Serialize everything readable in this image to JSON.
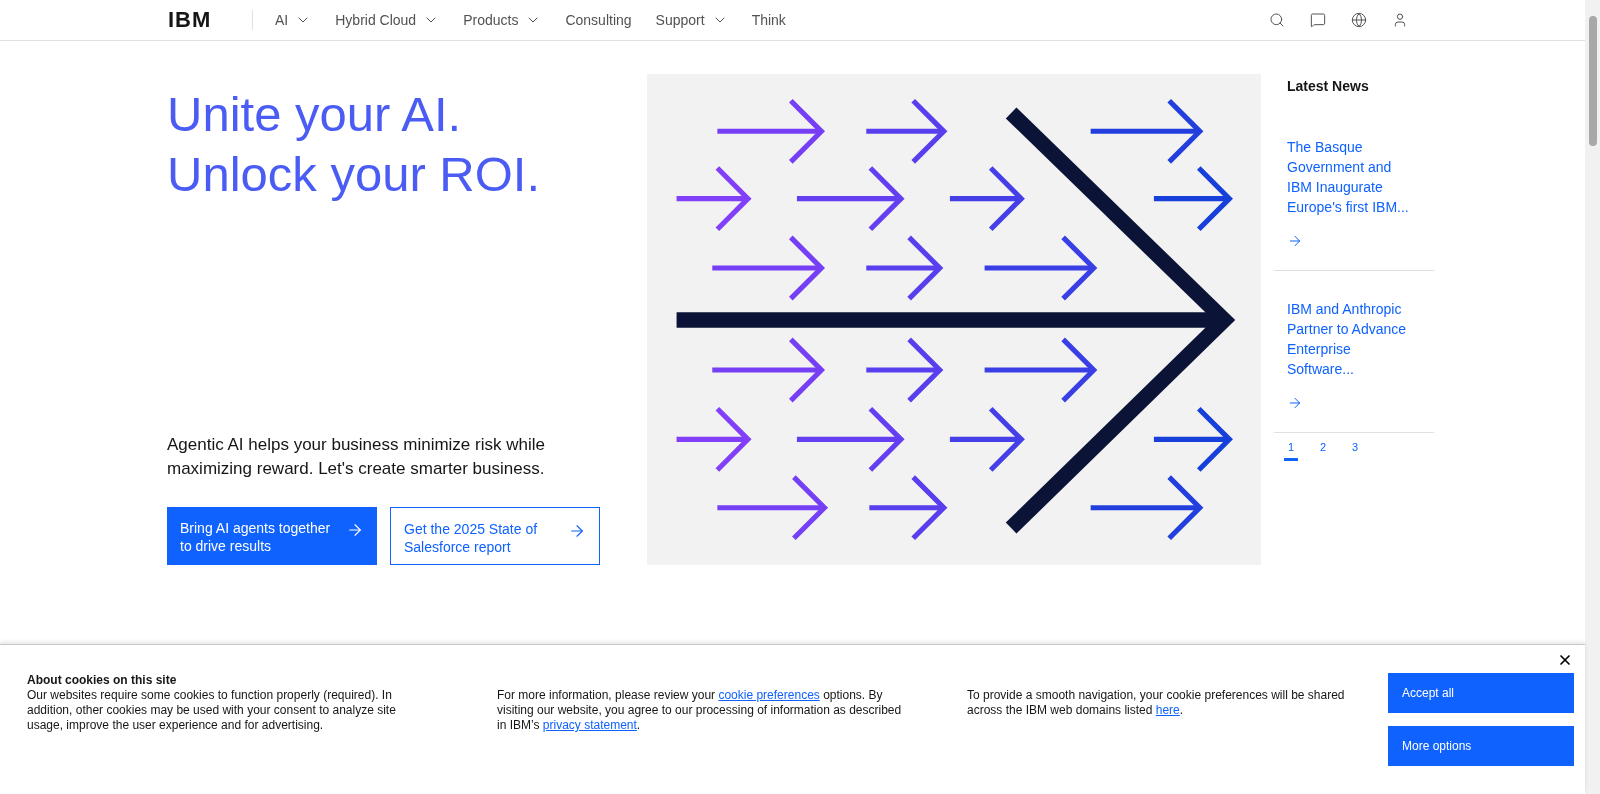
{
  "nav": {
    "logo": "IBM",
    "items": [
      {
        "label": "AI",
        "has_menu": true
      },
      {
        "label": "Hybrid Cloud",
        "has_menu": true
      },
      {
        "label": "Products",
        "has_menu": true
      },
      {
        "label": "Consulting",
        "has_menu": false
      },
      {
        "label": "Support",
        "has_menu": true
      },
      {
        "label": "Think",
        "has_menu": false
      }
    ]
  },
  "hero": {
    "title_lines": [
      "Unite your AI.",
      "Unlock your ROI."
    ],
    "description": "Agentic AI helps your business minimize risk while maximizing reward. Let's create smarter business.",
    "buttons": [
      {
        "label": "Bring AI agents together to drive results",
        "kind": "primary"
      },
      {
        "label": "Get the 2025 State of Salesforce report",
        "kind": "secondary"
      }
    ]
  },
  "news": {
    "title": "Latest News",
    "items": [
      {
        "headline": "The Basque Government and IBM Inaugurate Europe's first IBM..."
      },
      {
        "headline": "IBM and Anthropic Partner to Advance Enterprise Software..."
      }
    ],
    "pages": [
      {
        "label": "1",
        "selected": true
      },
      {
        "label": "2",
        "selected": false
      },
      {
        "label": "3",
        "selected": false
      }
    ]
  },
  "cookie_banner": {
    "title": "About cookies on this site",
    "text": "Our websites require some cookies to function properly (required). In addition, other cookies may be used with your consent to analyze site usage, improve the user experience and for advertising.",
    "info": [
      {
        "before": "For more information, please review your ",
        "link": "cookie preferences",
        "after": " options. By visiting our website, you agree to our processing of information as described in IBM’s "
      },
      {
        "link": "privacy statement",
        "after": "."
      }
    ],
    "domains": {
      "before": "To provide a smooth navigation, your cookie preferences will be shared across the IBM web domains listed ",
      "link": "here",
      "after": "."
    },
    "buttons": [
      "Accept all",
      "More options"
    ]
  }
}
